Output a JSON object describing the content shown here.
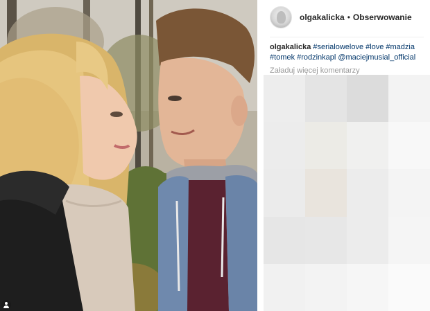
{
  "post": {
    "username": "olgakalicka",
    "separator": "•",
    "follow_label": "Obserwowanie"
  },
  "caption": {
    "author": "olgakalicka",
    "tags": [
      "#serialowelove",
      "#love",
      "#madzia",
      "#tomek",
      "#rodzinkapl",
      "@maciejmusial_official"
    ]
  },
  "comments": {
    "load_more": "Załaduj więcej komentarzy"
  },
  "icons": {
    "user_tag": "person-icon",
    "avatar": "profile-avatar"
  },
  "colors": {
    "text": "#262626",
    "hashtag": "#003569",
    "muted": "#999999",
    "divider": "#efefef"
  },
  "blurred_tiles": [
    "#ededed",
    "#e4e4e4",
    "#dcdcdc",
    "#f3f3f3",
    "#ececec",
    "#ecebe6",
    "#f0f0ef",
    "#f8f8f8",
    "#ebebeb",
    "#e9e4dd",
    "#ececec",
    "#f4f4f4",
    "#e6e6e6",
    "#e7e7e7",
    "#ececec",
    "#f5f5f5",
    "#f1f1f1",
    "#f3f3f3",
    "#f6f6f6",
    "#fafafa"
  ]
}
